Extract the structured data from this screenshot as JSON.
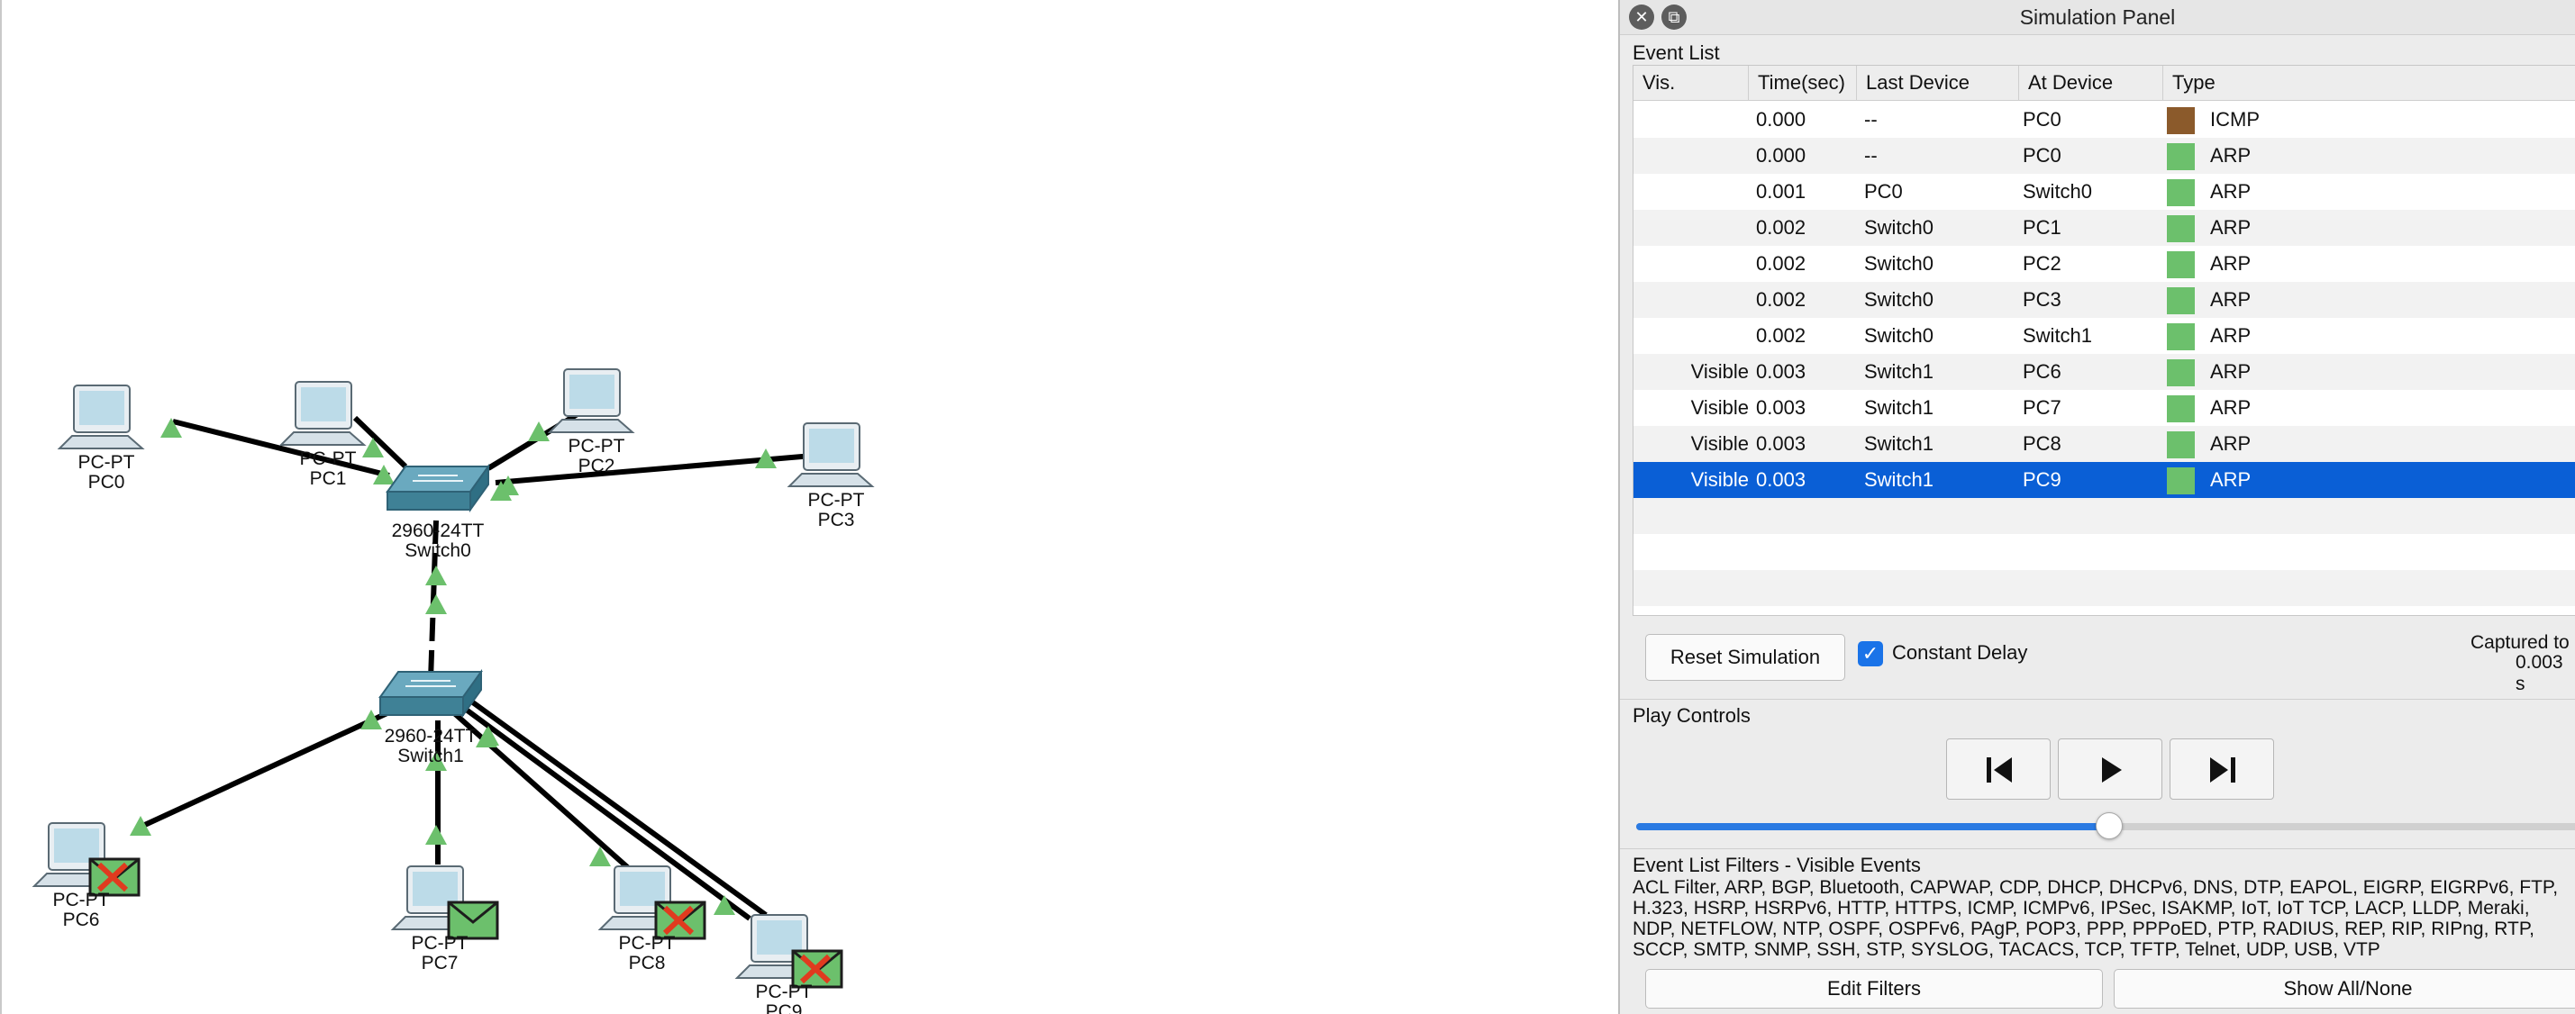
{
  "panel": {
    "title": "Simulation Panel",
    "event_list_label": "Event List",
    "columns": [
      "Vis.",
      "Time(sec)",
      "Last Device",
      "At Device",
      "Type"
    ],
    "events": [
      {
        "vis": "",
        "time": "0.000",
        "last": "--",
        "at": "PC0",
        "type": "ICMP",
        "color": "#8b5a2b"
      },
      {
        "vis": "",
        "time": "0.000",
        "last": "--",
        "at": "PC0",
        "type": "ARP",
        "color": "#6cc06c"
      },
      {
        "vis": "",
        "time": "0.001",
        "last": "PC0",
        "at": "Switch0",
        "type": "ARP",
        "color": "#6cc06c"
      },
      {
        "vis": "",
        "time": "0.002",
        "last": "Switch0",
        "at": "PC1",
        "type": "ARP",
        "color": "#6cc06c"
      },
      {
        "vis": "",
        "time": "0.002",
        "last": "Switch0",
        "at": "PC2",
        "type": "ARP",
        "color": "#6cc06c"
      },
      {
        "vis": "",
        "time": "0.002",
        "last": "Switch0",
        "at": "PC3",
        "type": "ARP",
        "color": "#6cc06c"
      },
      {
        "vis": "",
        "time": "0.002",
        "last": "Switch0",
        "at": "Switch1",
        "type": "ARP",
        "color": "#6cc06c"
      },
      {
        "vis": "Visible",
        "time": "0.003",
        "last": "Switch1",
        "at": "PC6",
        "type": "ARP",
        "color": "#6cc06c"
      },
      {
        "vis": "Visible",
        "time": "0.003",
        "last": "Switch1",
        "at": "PC7",
        "type": "ARP",
        "color": "#6cc06c"
      },
      {
        "vis": "Visible",
        "time": "0.003",
        "last": "Switch1",
        "at": "PC8",
        "type": "ARP",
        "color": "#6cc06c"
      },
      {
        "vis": "Visible",
        "time": "0.003",
        "last": "Switch1",
        "at": "PC9",
        "type": "ARP",
        "color": "#6cc06c",
        "selected": true
      }
    ],
    "reset_label": "Reset Simulation",
    "constant_delay_label": "Constant Delay",
    "constant_delay_checked": true,
    "captured_label": "Captured to",
    "captured_value": "0.003 s",
    "play_controls_label": "Play Controls",
    "play_buttons": [
      "skip-back-icon",
      "play-icon",
      "skip-forward-icon"
    ],
    "playback_speed": 0.5,
    "filters_label": "Event List Filters - Visible Events",
    "filters_text": "ACL Filter, ARP, BGP, Bluetooth, CAPWAP, CDP, DHCP, DHCPv6, DNS, DTP, EAPOL, EIGRP, EIGRPv6, FTP, H.323, HSRP, HSRPv6, HTTP, HTTPS, ICMP, ICMPv6, IPSec, ISAKMP, IoT, IoT TCP, LACP, LLDP, Meraki, NDP, NETFLOW, NTP, OSPF, OSPFv6, PAgP, POP3, PPP, PPPoED, PTP, RADIUS, REP, RIP, RIPng, RTP, SCCP, SMTP, SNMP, SSH, STP, SYSLOG, TACACS, TCP, TFTP, Telnet, UDP, USB, VTP",
    "edit_filters_label": "Edit Filters",
    "show_all_label": "Show All/None"
  },
  "topology": {
    "pc_model": "PC-PT",
    "switch_model": "2960-24TT",
    "pcs": [
      "PC0",
      "PC1",
      "PC2",
      "PC3",
      "PC6",
      "PC7",
      "PC8",
      "PC9"
    ],
    "switches": [
      "Switch0",
      "Switch1"
    ],
    "link_color": "#000000",
    "link_light_color": "#6cc06c",
    "envelope_color": "#6cc06c",
    "fail_mark_color": "#e03b1f"
  }
}
